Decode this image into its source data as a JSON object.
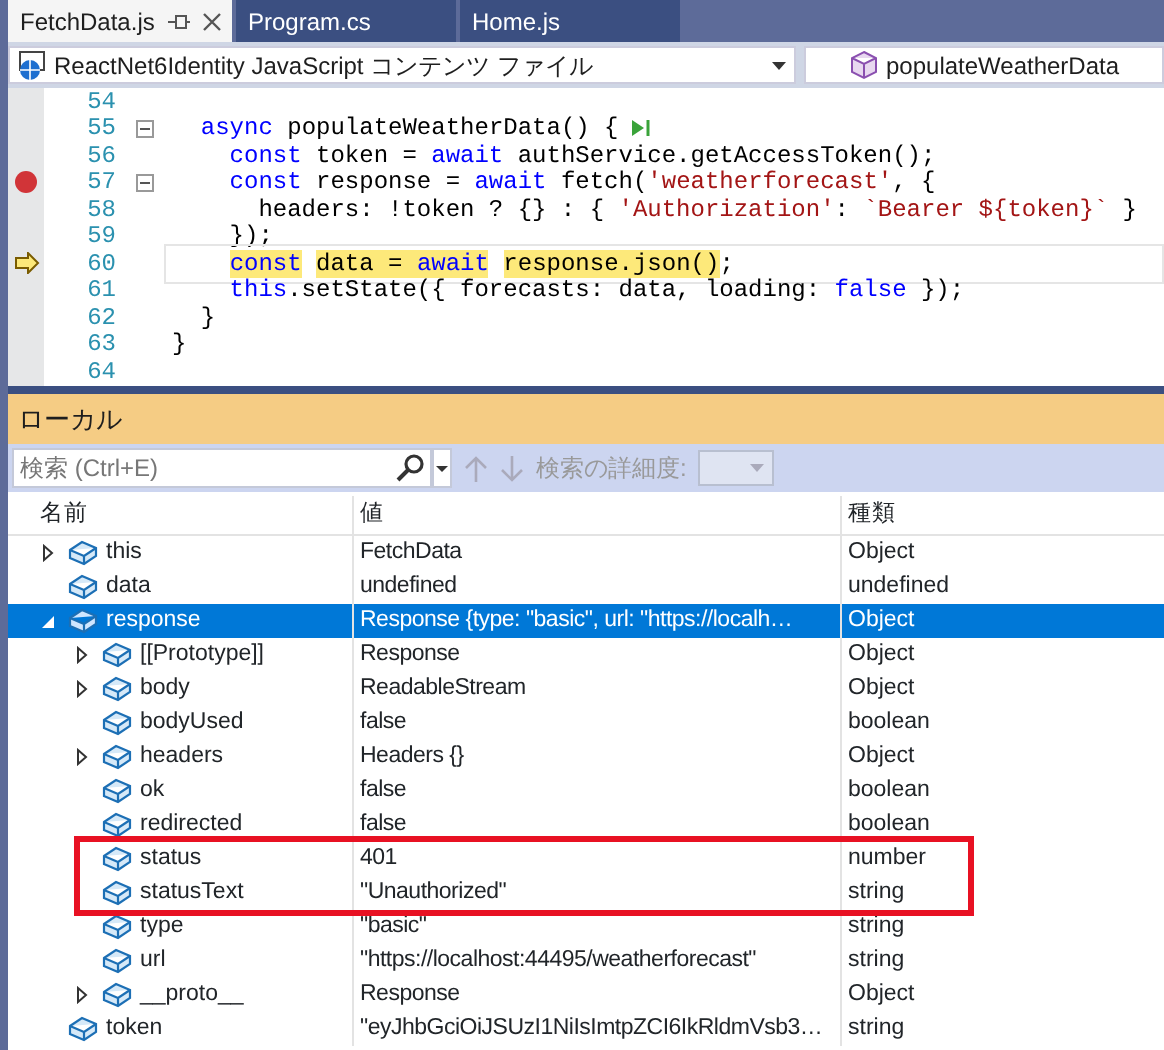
{
  "tabs": [
    {
      "label": "FetchData.js",
      "selected": true
    },
    {
      "label": "Program.cs",
      "selected": false
    },
    {
      "label": "Home.js",
      "selected": false
    }
  ],
  "navigation_bar": {
    "project": "ReactNet6Identity JavaScript コンテンツ ファイル",
    "member": "populateWeatherData"
  },
  "code_editor": {
    "lines": [
      {
        "number": "54",
        "breakpoint": false,
        "current": false,
        "fold": false,
        "run_icon": false
      },
      {
        "number": "55",
        "breakpoint": false,
        "current": false,
        "fold": true,
        "run_icon": true,
        "tokens": [
          {
            "kind": "keyword",
            "text": "  async"
          },
          {
            "kind": "plain",
            "text": " populateWeatherData() {"
          }
        ]
      },
      {
        "number": "56",
        "breakpoint": false,
        "current": false,
        "fold": false,
        "run_icon": false,
        "tokens": [
          {
            "kind": "keyword",
            "text": "    const"
          },
          {
            "kind": "plain",
            "text": " token = "
          },
          {
            "kind": "keyword",
            "text": "await"
          },
          {
            "kind": "plain",
            "text": " authService.getAccessToken();"
          }
        ]
      },
      {
        "number": "57",
        "breakpoint": true,
        "current": false,
        "fold": true,
        "run_icon": false,
        "tokens": [
          {
            "kind": "keyword",
            "text": "    const"
          },
          {
            "kind": "plain",
            "text": " response = "
          },
          {
            "kind": "keyword",
            "text": "await"
          },
          {
            "kind": "plain",
            "text": " fetch("
          },
          {
            "kind": "string",
            "text": "'weatherforecast'"
          },
          {
            "kind": "plain",
            "text": ", {"
          }
        ]
      },
      {
        "number": "58",
        "breakpoint": false,
        "current": false,
        "fold": false,
        "run_icon": false,
        "tokens": [
          {
            "kind": "plain",
            "text": "      headers: !token ? {} : { "
          },
          {
            "kind": "string",
            "text": "'Authorization'"
          },
          {
            "kind": "plain",
            "text": ": "
          },
          {
            "kind": "string",
            "text": "`Bearer ${token}`"
          },
          {
            "kind": "plain",
            "text": " }"
          }
        ]
      },
      {
        "number": "59",
        "breakpoint": false,
        "current": false,
        "fold": false,
        "run_icon": false,
        "tokens": [
          {
            "kind": "plain",
            "text": "    });"
          }
        ]
      },
      {
        "number": "60",
        "breakpoint": false,
        "current": true,
        "fold": false,
        "run_icon": false,
        "tokens": [
          {
            "kind": "keyword",
            "text": "    const"
          },
          {
            "kind": "plain",
            "text": " data = "
          },
          {
            "kind": "keyword",
            "text": "await"
          },
          {
            "kind": "plain",
            "text": " response.json()"
          },
          {
            "kind": "plain",
            "text": ";"
          }
        ]
      },
      {
        "number": "61",
        "breakpoint": false,
        "current": false,
        "fold": false,
        "run_icon": false,
        "tokens": [
          {
            "kind": "keyword",
            "text": "    this"
          },
          {
            "kind": "plain",
            "text": ".setState({ forecasts: data, loading: "
          },
          {
            "kind": "keyword",
            "text": "false"
          },
          {
            "kind": "plain",
            "text": " });"
          }
        ]
      },
      {
        "number": "62",
        "breakpoint": false,
        "current": false,
        "fold": false,
        "run_icon": false,
        "tokens": [
          {
            "kind": "plain",
            "text": "  }"
          }
        ]
      },
      {
        "number": "63",
        "breakpoint": false,
        "current": false,
        "fold": false,
        "run_icon": false,
        "tokens": [
          {
            "kind": "plain",
            "text": "}"
          }
        ]
      },
      {
        "number": "64",
        "breakpoint": false,
        "current": false,
        "fold": false,
        "run_icon": false
      }
    ]
  },
  "locals_panel": {
    "title": "ローカル",
    "search": {
      "placeholder": "検索 (Ctrl+E)"
    },
    "depth_label": "検索の詳細度:",
    "columns": [
      "名前",
      "値",
      "種類"
    ],
    "rows": [
      {
        "name": "this",
        "value": "FetchData",
        "type": "Object",
        "expanded": false,
        "selected": false,
        "highlighted": false
      },
      {
        "name": "data",
        "value": "undefined",
        "type": "undefined",
        "selected": false,
        "highlighted": false
      },
      {
        "name": "response",
        "value": "Response {type: \"basic\", url: \"https://localh…",
        "type": "Object",
        "expanded": true,
        "selected": true,
        "highlighted": false,
        "children": [
          {
            "name": "[[Prototype]]",
            "value": "Response",
            "type": "Object",
            "expanded": false,
            "selected": false,
            "highlighted": false
          },
          {
            "name": "body",
            "value": "ReadableStream",
            "type": "Object",
            "expanded": false,
            "selected": false,
            "highlighted": false
          },
          {
            "name": "bodyUsed",
            "value": "false",
            "type": "boolean",
            "selected": false,
            "highlighted": false
          },
          {
            "name": "headers",
            "value": "Headers {}",
            "type": "Object",
            "expanded": false,
            "selected": false,
            "highlighted": false
          },
          {
            "name": "ok",
            "value": "false",
            "type": "boolean",
            "selected": false,
            "highlighted": false
          },
          {
            "name": "redirected",
            "value": "false",
            "type": "boolean",
            "selected": false,
            "highlighted": false
          },
          {
            "name": "status",
            "value": "401",
            "type": "number",
            "selected": false,
            "highlighted": true
          },
          {
            "name": "statusText",
            "value": "\"Unauthorized\"",
            "type": "string",
            "selected": false,
            "highlighted": true
          },
          {
            "name": "type",
            "value": "\"basic\"",
            "type": "string",
            "selected": false,
            "highlighted": false
          },
          {
            "name": "url",
            "value": "\"https://localhost:44495/weatherforecast\"",
            "type": "string",
            "selected": false,
            "highlighted": false
          },
          {
            "name": "__proto__",
            "value": "Response",
            "type": "Object",
            "expanded": false,
            "selected": false,
            "highlighted": false
          }
        ]
      },
      {
        "name": "token",
        "value": "\"eyJhbGciOiJSUzI1NiIsImtpZCI6IkRldmVsb3…",
        "type": "string",
        "selected": false,
        "highlighted": false
      }
    ]
  }
}
